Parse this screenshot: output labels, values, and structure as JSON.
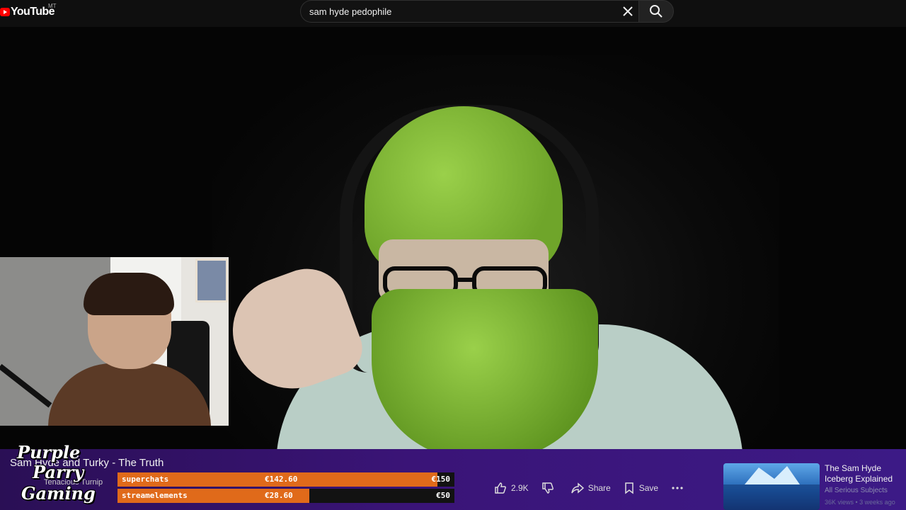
{
  "header": {
    "logo_text": "YouTube",
    "region": "MT",
    "search_value": "sam hyde pedophile"
  },
  "video": {
    "title": "Sam Hyde and Turky - The Truth",
    "channel": "Tenacious Turnip"
  },
  "overlay": {
    "brand_lines": [
      "Purple",
      "Parry",
      "Gaming"
    ],
    "goals": [
      {
        "label": "superchats",
        "current": "€142.60",
        "goal": "€150",
        "progress": 0.95
      },
      {
        "label": "streamelements",
        "current": "€28.60",
        "goal": "€50",
        "progress": 0.57
      }
    ]
  },
  "actions": {
    "like_count": "2.9K",
    "share_label": "Share",
    "save_label": "Save"
  },
  "recommendation": {
    "title": "The Sam Hyde Iceberg Explained",
    "channel": "All Serious Subjects",
    "meta": "36K views • 3 weeks ago"
  },
  "icons": [
    "youtube-logo",
    "clear-icon",
    "search-icon",
    "like-icon",
    "dislike-icon",
    "share-icon",
    "save-icon",
    "more-icon"
  ]
}
